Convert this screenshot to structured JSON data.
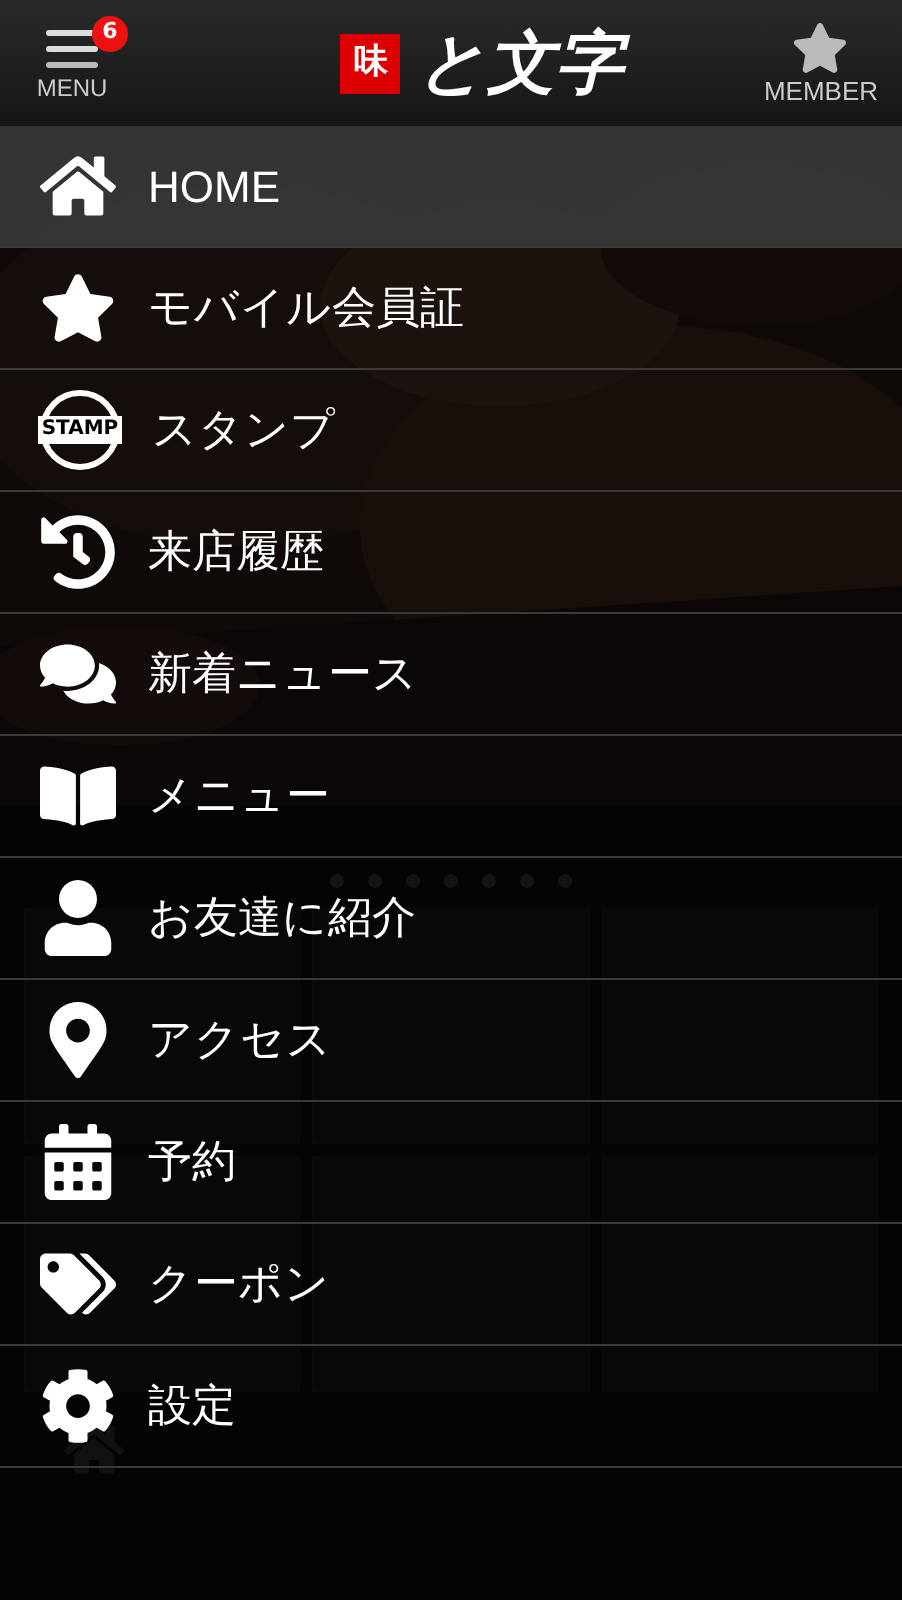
{
  "header": {
    "menu_button": {
      "label": "MENU",
      "badge": "6"
    },
    "logo": {
      "mark": "味",
      "name": "と文字"
    },
    "member_button": {
      "label": "MEMBER"
    }
  },
  "menu": {
    "items": [
      {
        "label": "HOME",
        "selected": true
      },
      {
        "label": "モバイル会員証",
        "selected": false
      },
      {
        "label": "スタンプ",
        "selected": false,
        "icon_text": "STAMP"
      },
      {
        "label": "来店履歴",
        "selected": false
      },
      {
        "label": "新着ニュース",
        "selected": false
      },
      {
        "label": "メニュー",
        "selected": false
      },
      {
        "label": "お友達に紹介",
        "selected": false
      },
      {
        "label": "アクセス",
        "selected": false
      },
      {
        "label": "予約",
        "selected": false
      },
      {
        "label": "クーポン",
        "selected": false
      },
      {
        "label": "設定",
        "selected": false
      }
    ]
  }
}
